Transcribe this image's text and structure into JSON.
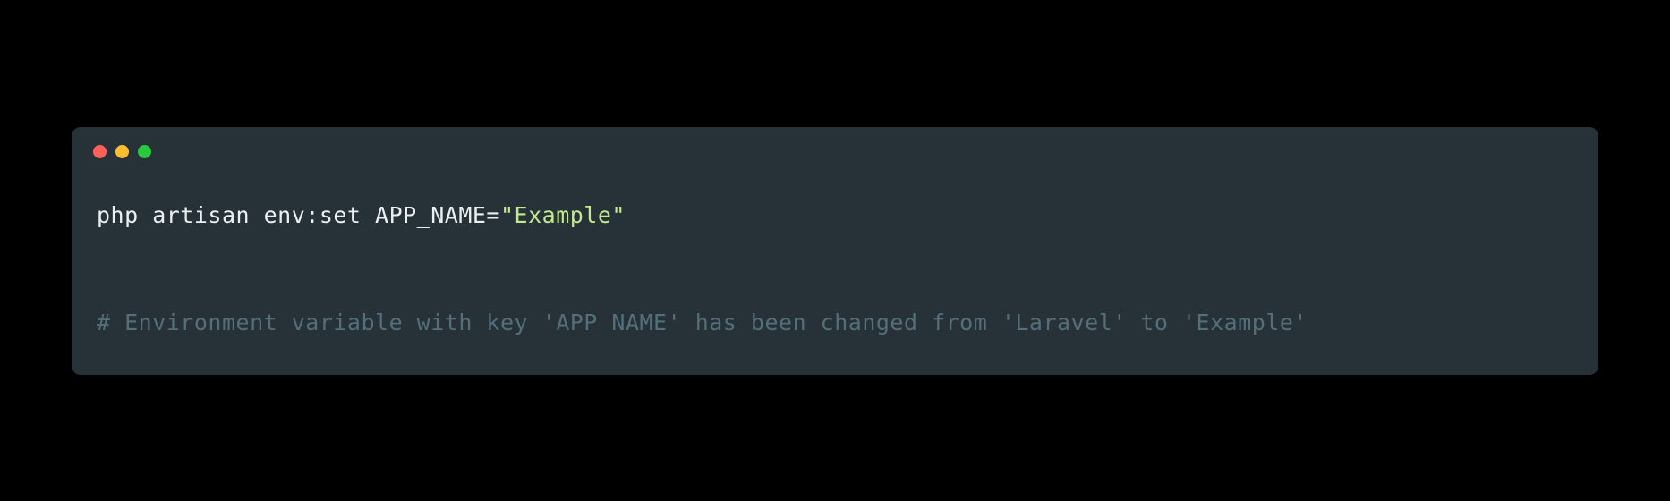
{
  "terminal": {
    "command": {
      "prefix": "php artisan env:set APP_NAME=",
      "string_value": "\"Example\""
    },
    "comment": "# Environment variable with key 'APP_NAME' has been changed from 'Laravel' to 'Example'"
  },
  "colors": {
    "background": "#000000",
    "terminal_bg": "#263238",
    "text": "#eceff1",
    "string": "#c3e88d",
    "comment": "#546e7a"
  }
}
